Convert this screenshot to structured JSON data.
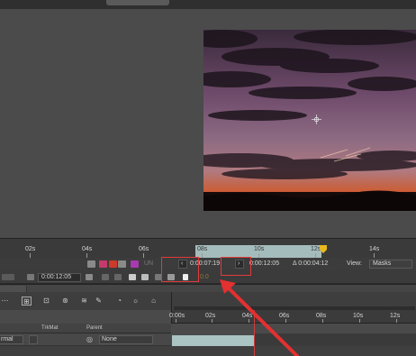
{
  "ruler": {
    "labels": [
      "02s",
      "04s",
      "06s",
      "08s",
      "10s",
      "12s",
      "14s"
    ]
  },
  "viewer_bar": {
    "current_time": "0:00:07:19",
    "prev_frame": "‹",
    "next_frame": "›",
    "end_time": "0:00:12:05",
    "duration": "Δ 0:00:04:12",
    "view_label": "View:",
    "view_value": "Masks",
    "faded": "UN"
  },
  "comp_bar": {
    "timecode": "0:00:12:05",
    "faded_value": "0.0"
  },
  "timeline": {
    "ruler_labels": [
      "0:00s",
      "02s",
      "04s",
      "06s",
      "08s",
      "10s",
      "12s"
    ],
    "columns": {
      "trkmat": "TrkMat",
      "parent": "Parent"
    },
    "layer": {
      "mode": "rmal",
      "parent": "None"
    }
  },
  "colors": {
    "highlight": "#e23a3a",
    "work_area": "#b9d3d3",
    "layer_bar": "#a9c4c2"
  }
}
